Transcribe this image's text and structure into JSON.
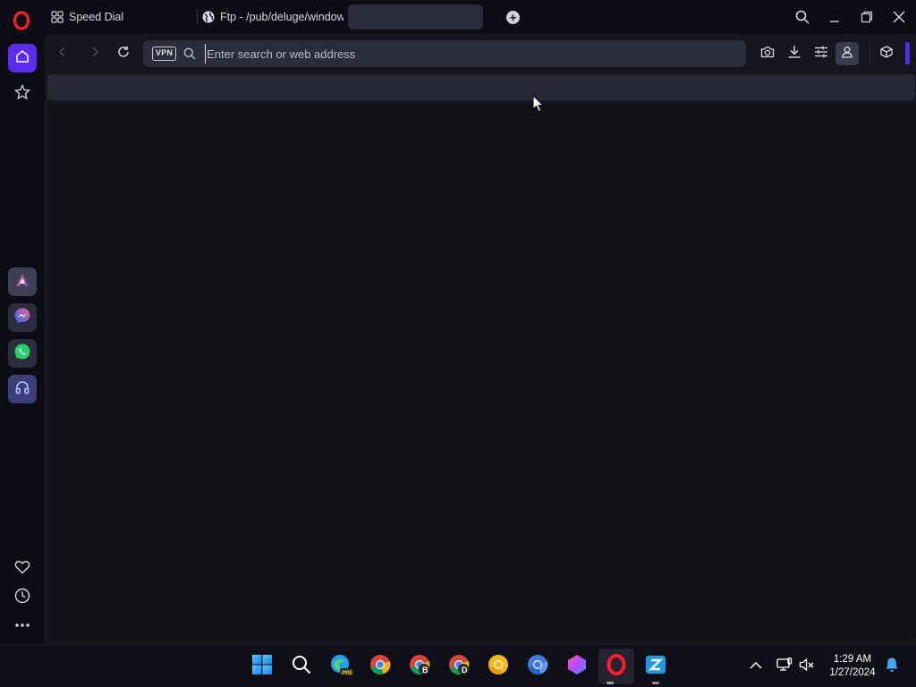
{
  "tabs": [
    {
      "label": "Speed Dial",
      "icon": "speed-dial-grid-icon"
    },
    {
      "label": "Ftp - /pub/deluge/window",
      "icon": "globe-icon"
    },
    {
      "label": "",
      "icon": ""
    }
  ],
  "toolbar": {
    "vpn_label": "VPN",
    "address_placeholder": "Enter search or web address",
    "address_value": ""
  },
  "sidebar": {
    "items": [
      "home-icon",
      "star-icon",
      "aria-icon",
      "messenger-icon",
      "whatsapp-icon",
      "music-player-icon",
      "heart-icon",
      "history-icon",
      "more-icon"
    ]
  },
  "taskbar": {
    "time": "1:29 AM",
    "date": "1/27/2024",
    "edge_badge": "PRE",
    "chrome_b_badge": "B",
    "chrome_d_badge": "D"
  },
  "colors": {
    "accent": "#5b2bf0",
    "background": "#0b0c14",
    "frame": "#15161f"
  }
}
